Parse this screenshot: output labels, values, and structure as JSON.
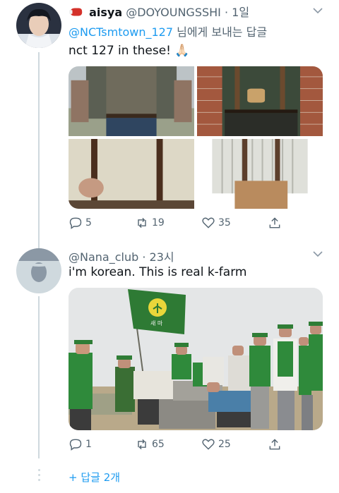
{
  "tweet1": {
    "display_name": "aisya",
    "handle": "@DOYOUNGSSHI",
    "time": "· 1일",
    "reply_to_mention": "@NCTsmtown_127",
    "reply_to_suffix": " 님에게 보내는 답글",
    "text": "nct 127 in these! 🙏🏻",
    "actions": {
      "replies": "5",
      "retweets": "19",
      "likes": "35"
    }
  },
  "tweet2": {
    "handle": "@Nana_club",
    "time": "· 23시",
    "text": "i'm korean. This is real k-farm",
    "flag_text": "새 마",
    "actions": {
      "replies": "1",
      "retweets": "65",
      "likes": "25"
    }
  },
  "more_replies": "+ 답글 2개",
  "colors": {
    "accent": "#1d9bf0",
    "muted": "#536471",
    "line": "#cfd9de"
  },
  "icons": {
    "reply": "reply-icon",
    "retweet": "retweet-icon",
    "like": "heart-icon",
    "share": "share-icon",
    "caret": "chevron-down-icon",
    "emoji": "boxing-glove-icon"
  }
}
